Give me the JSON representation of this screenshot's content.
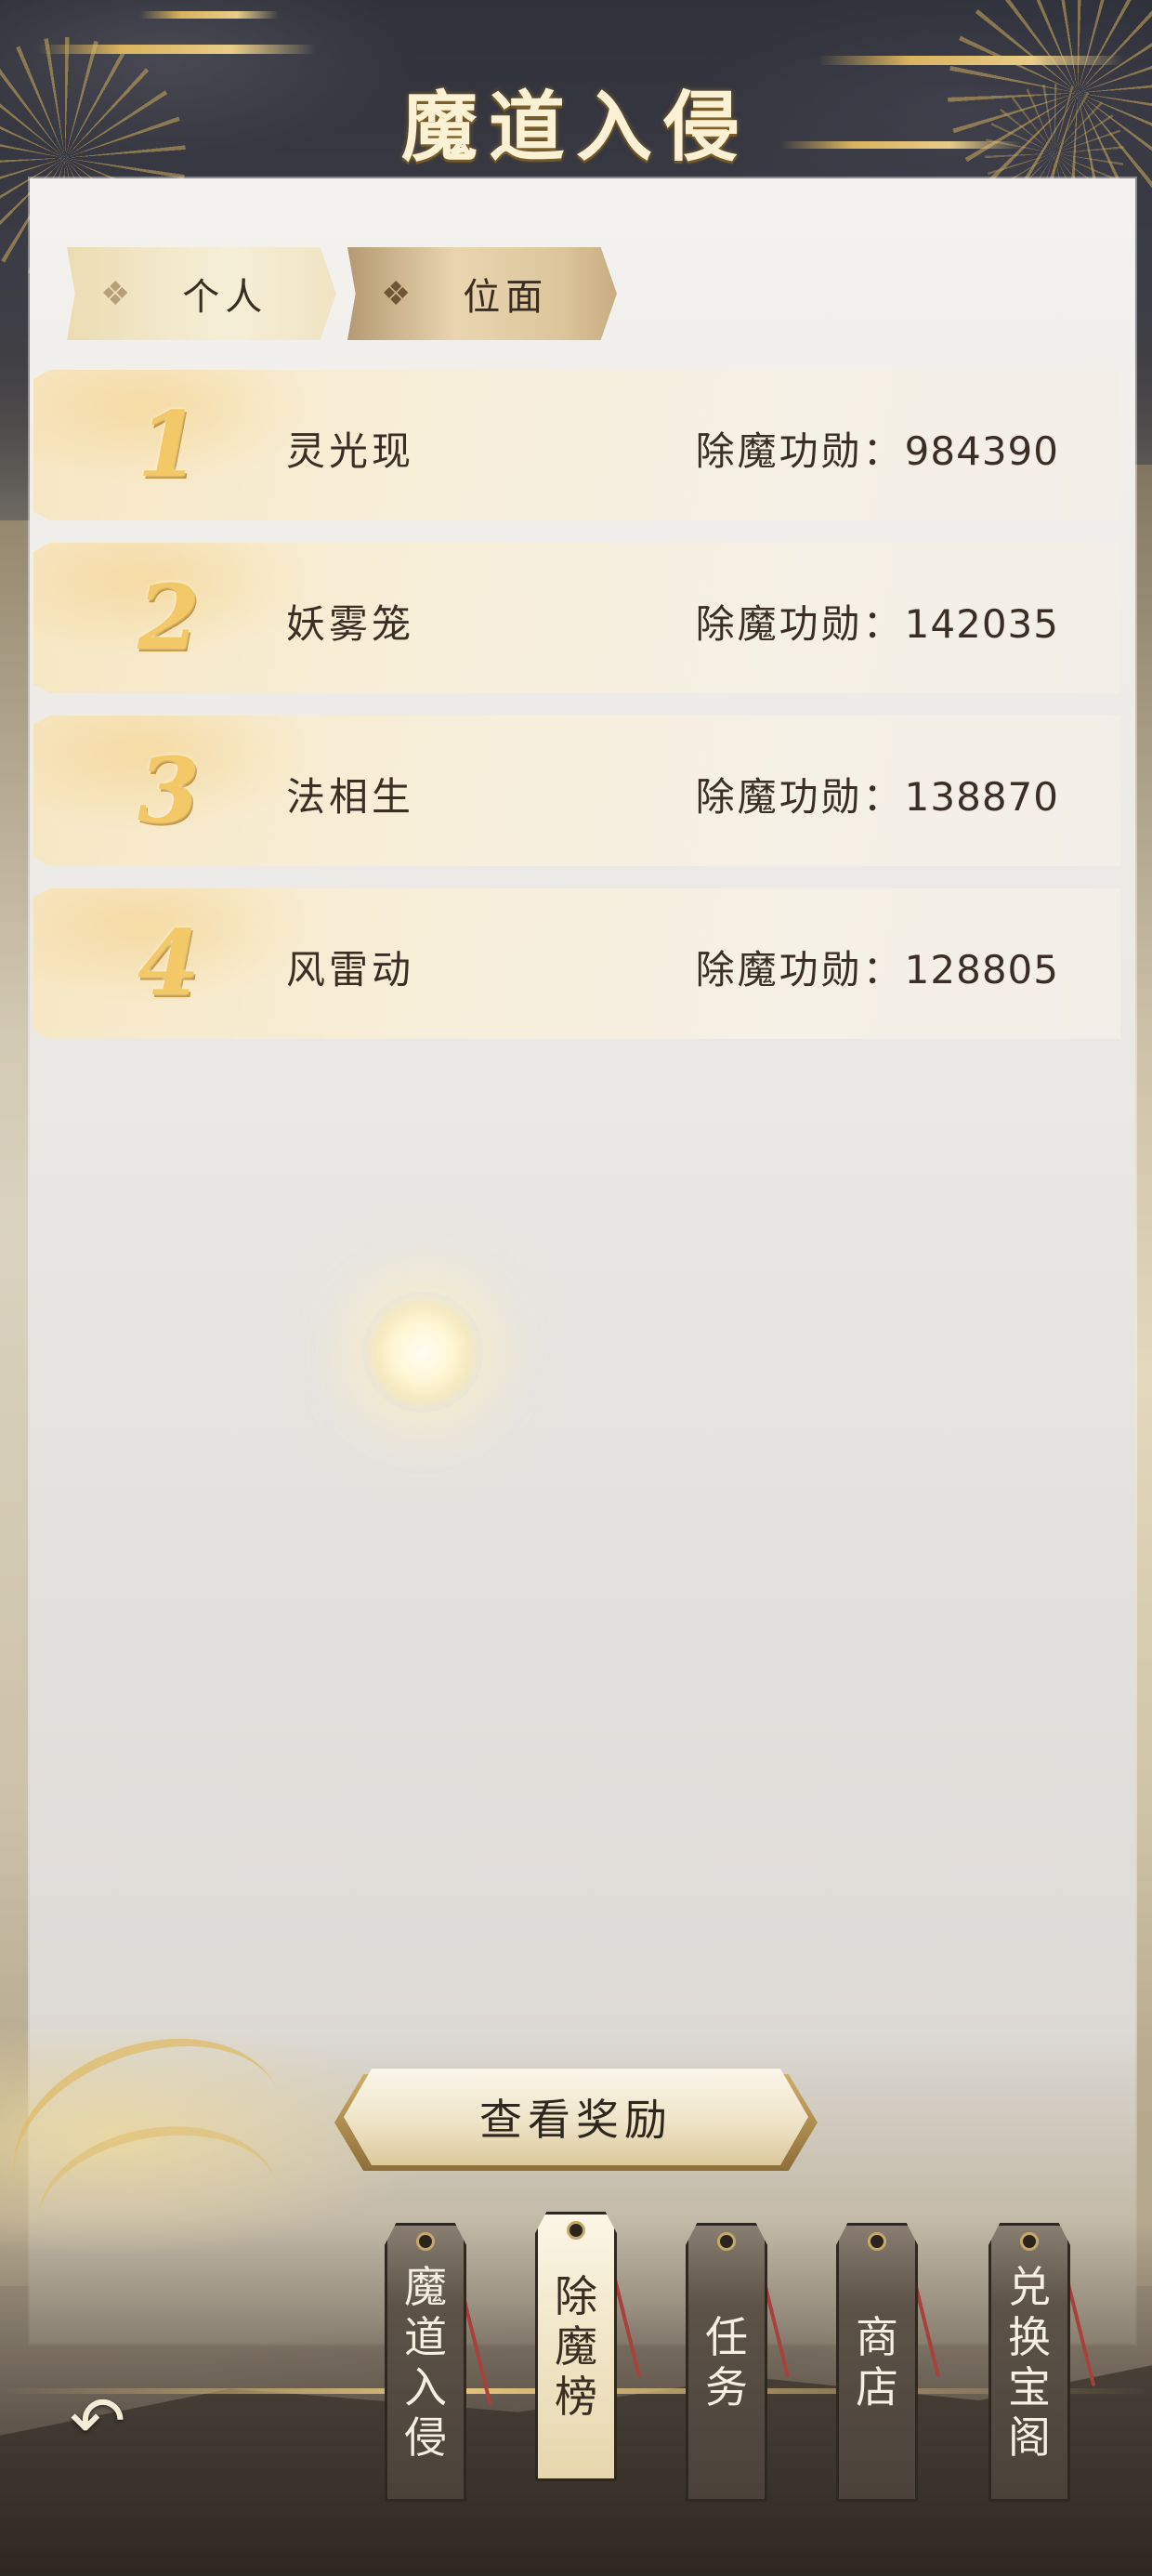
{
  "header": {
    "title": "魔道入侵"
  },
  "tabs": [
    {
      "label": "个人",
      "active": false
    },
    {
      "label": "位面",
      "active": true
    }
  ],
  "leaderboard": {
    "rows": [
      {
        "rank": "1",
        "name": "灵光现",
        "merit_label": "除魔功勋：",
        "merit_value": "984390"
      },
      {
        "rank": "2",
        "name": "妖雾笼",
        "merit_label": "除魔功勋：",
        "merit_value": "142035"
      },
      {
        "rank": "3",
        "name": "法相生",
        "merit_label": "除魔功勋：",
        "merit_value": "138870"
      },
      {
        "rank": "4",
        "name": "风雷动",
        "merit_label": "除魔功勋：",
        "merit_value": "128805"
      }
    ]
  },
  "reward_button": {
    "label": "查看奖励"
  },
  "bottom_nav": [
    {
      "label_chars": [
        "魔",
        "道",
        "入",
        "侵"
      ],
      "active": false
    },
    {
      "label_chars": [
        "除",
        "魔",
        "榜"
      ],
      "active": true
    },
    {
      "label_chars": [
        "任",
        "务"
      ],
      "active": false
    },
    {
      "label_chars": [
        "商",
        "店"
      ],
      "active": false
    },
    {
      "label_chars": [
        "兑",
        "换",
        "宝",
        "阁"
      ],
      "active": false
    }
  ],
  "back_button": {
    "icon": "back-arrow-icon",
    "glyph": "↶"
  },
  "colors": {
    "accent_gold": "#e0bd6f",
    "text_dark": "#3b2f25",
    "title_text": "#fbf2d6"
  }
}
